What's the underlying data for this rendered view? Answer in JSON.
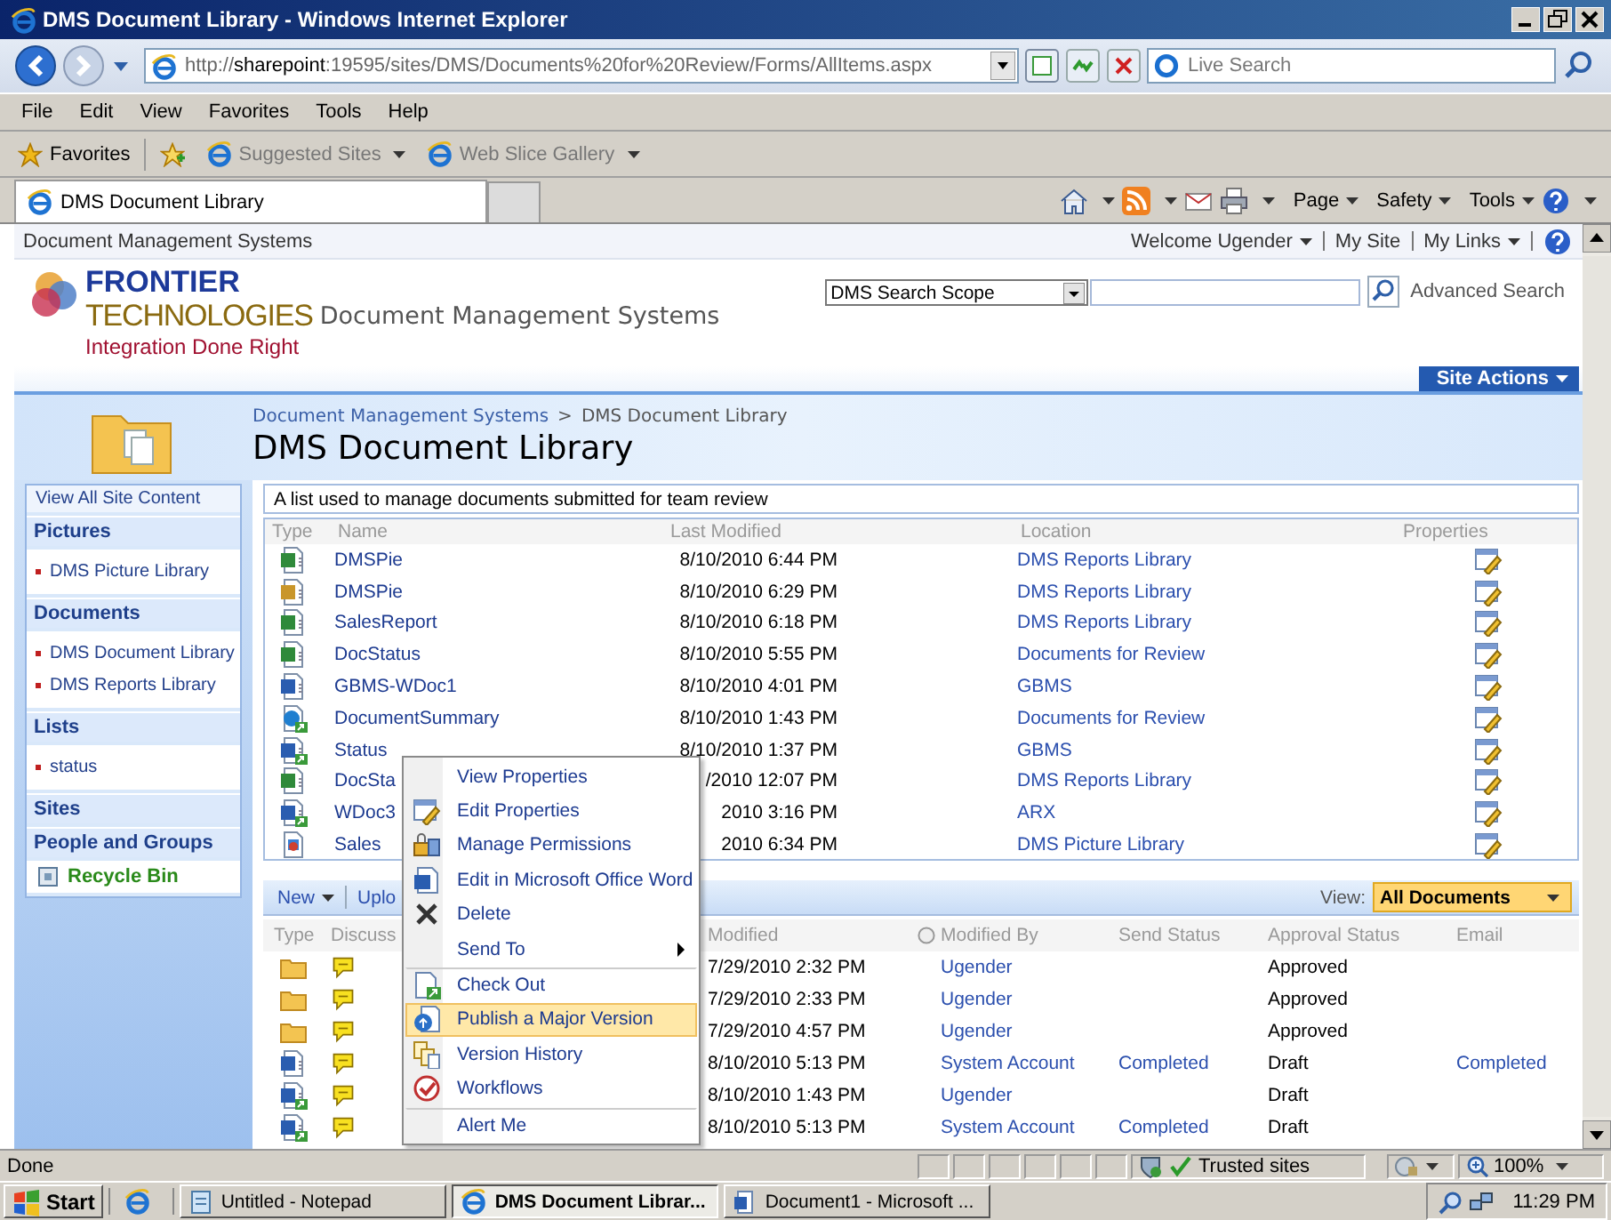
{
  "window": {
    "title": "DMS Document Library - Windows Internet Explorer"
  },
  "address_bar": {
    "url": "http://**sharepoint**:19595/sites/DMS/Documents%20for%20Review/Forms/AllItems.aspx",
    "search_placeholder": "Live Search"
  },
  "menu_bar": [
    "File",
    "Edit",
    "View",
    "Favorites",
    "Tools",
    "Help"
  ],
  "favorites_bar": {
    "label": "Favorites",
    "links": [
      "Suggested Sites",
      "Web Slice Gallery"
    ]
  },
  "tabs": [
    {
      "label": "DMS Document Library",
      "selected": true
    }
  ],
  "command_bar": [
    "Page",
    "Safety",
    "Tools"
  ],
  "site_header": {
    "site_name": "Document Management Systems",
    "welcome": "Welcome Ugender",
    "links": [
      {
        "label": "My Site",
        "dropdown": false
      },
      {
        "label": "My Links",
        "dropdown": true
      }
    ],
    "logo": {
      "line1": "FRONTIER",
      "line2": "TECHNOLOGIES",
      "tagline": "Integration Done Right"
    },
    "site_title": "Document Management Systems",
    "search_scope": "DMS Search Scope",
    "advanced_search": "Advanced Search",
    "site_actions": "Site Actions"
  },
  "title_area": {
    "breadcrumb": [
      "Document Management Systems",
      "DMS Document Library"
    ],
    "separator": ">",
    "title": "DMS Document Library"
  },
  "sidebar": {
    "top_link": "View All Site Content",
    "groups": [
      {
        "heading": "Pictures",
        "items": [
          "DMS Picture Library"
        ]
      },
      {
        "heading": "Documents",
        "items": [
          "DMS Document Library",
          "DMS Reports Library"
        ]
      },
      {
        "heading": "Lists",
        "items": [
          "status"
        ]
      },
      {
        "heading": "Sites"
      },
      {
        "heading": "People and Groups"
      }
    ],
    "recycle_bin": "Recycle Bin"
  },
  "list": {
    "description": "A list used to manage documents submitted for team review",
    "columns": [
      "Type",
      "Name",
      "Last Modified",
      "Location",
      "Properties"
    ],
    "rows": [
      {
        "kind": "spreadsheet",
        "linked": false,
        "name": "DMSPie",
        "modified": "8/10/2010 6:44 PM",
        "location": "DMS Reports Library"
      },
      {
        "kind": "form",
        "linked": false,
        "name": "DMSPie",
        "modified": "8/10/2010 6:29 PM",
        "location": "DMS Reports Library"
      },
      {
        "kind": "spreadsheet",
        "linked": false,
        "name": "SalesReport",
        "modified": "8/10/2010 6:18 PM",
        "location": "DMS Reports Library"
      },
      {
        "kind": "spreadsheet",
        "linked": false,
        "name": "DocStatus",
        "modified": "8/10/2010 5:55 PM",
        "location": "Documents for Review"
      },
      {
        "kind": "document",
        "linked": false,
        "name": "GBMS-WDoc1",
        "modified": "8/10/2010 4:01 PM",
        "location": "GBMS"
      },
      {
        "kind": "web",
        "linked": true,
        "name": "DocumentSummary",
        "modified": "8/10/2010 1:43 PM",
        "location": "Documents for Review"
      },
      {
        "kind": "document",
        "linked": true,
        "name": "Status",
        "modified": "8/10/2010 1:37 PM",
        "location": "GBMS"
      },
      {
        "kind": "spreadsheet",
        "linked": false,
        "name": "DocSta",
        "modified": "/2010 12:07 PM",
        "location": "DMS Reports Library"
      },
      {
        "kind": "document",
        "linked": true,
        "name": "WDoc3",
        "modified": "2010 3:16 PM",
        "location": "ARX"
      },
      {
        "kind": "image",
        "linked": false,
        "name": "Sales",
        "modified": "2010 6:34 PM",
        "location": "DMS Picture Library"
      }
    ]
  },
  "library": {
    "toolbar": {
      "new": "New",
      "upload": "Uplo",
      "view_label": "View:",
      "view": "All Documents"
    },
    "columns": [
      "Type",
      "Discuss",
      "Modified",
      "Modified By",
      "Send Status",
      "Approval Status",
      "Email"
    ],
    "rows": [
      {
        "kind": "folder",
        "linked": false,
        "modified": "7/29/2010 2:32 PM",
        "modified_by": "Ugender",
        "approval": "Approved"
      },
      {
        "kind": "folder",
        "linked": false,
        "modified": "7/29/2010 2:33 PM",
        "modified_by": "Ugender",
        "approval": "Approved"
      },
      {
        "kind": "folder",
        "linked": false,
        "modified": "7/29/2010 4:57 PM",
        "modified_by": "Ugender",
        "approval": "Approved"
      },
      {
        "kind": "document",
        "linked": false,
        "modified": "8/10/2010 5:13 PM",
        "modified_by": "System Account",
        "send_status": "Completed",
        "approval": "Draft",
        "email": "Completed"
      },
      {
        "kind": "document",
        "linked": true,
        "modified": "8/10/2010 1:43 PM",
        "modified_by": "Ugender",
        "approval": "Draft"
      },
      {
        "kind": "document",
        "linked": true,
        "modified": "8/10/2010 5:13 PM",
        "modified_by": "System Account",
        "send_status": "Completed",
        "approval": "Draft"
      }
    ]
  },
  "context_menu": [
    {
      "label": "View Properties",
      "selected": false,
      "separator_before": false,
      "submenu": false
    },
    {
      "label": "Edit Properties",
      "selected": false,
      "separator_before": false,
      "submenu": false
    },
    {
      "label": "Manage Permissions",
      "selected": false,
      "separator_before": false,
      "submenu": false
    },
    {
      "label": "Edit in Microsoft Office Word",
      "selected": false,
      "separator_before": false,
      "submenu": false
    },
    {
      "label": "Delete",
      "selected": false,
      "separator_before": false,
      "submenu": false
    },
    {
      "label": "Send To",
      "selected": false,
      "separator_before": false,
      "submenu": true
    },
    {
      "label": "Check Out",
      "selected": false,
      "separator_before": true,
      "submenu": false
    },
    {
      "label": "Publish a Major Version",
      "selected": true,
      "separator_before": false,
      "submenu": false
    },
    {
      "label": "Version History",
      "selected": false,
      "separator_before": false,
      "submenu": false
    },
    {
      "label": "Workflows",
      "selected": false,
      "separator_before": false,
      "submenu": false
    },
    {
      "label": "Alert Me",
      "selected": false,
      "separator_before": true,
      "submenu": false
    }
  ],
  "status_bar": {
    "text": "Done",
    "zone": "Trusted sites",
    "zoom": "100%"
  },
  "taskbar": {
    "start": "Start",
    "buttons": [
      {
        "label": "Untitled - Notepad",
        "kind": "notepad",
        "selected": false
      },
      {
        "label": "DMS Document Librar...",
        "kind": "browser",
        "selected": true
      },
      {
        "label": "Document1 - Microsoft ...",
        "kind": "word",
        "selected": false
      }
    ],
    "clock": "11:29 PM"
  }
}
